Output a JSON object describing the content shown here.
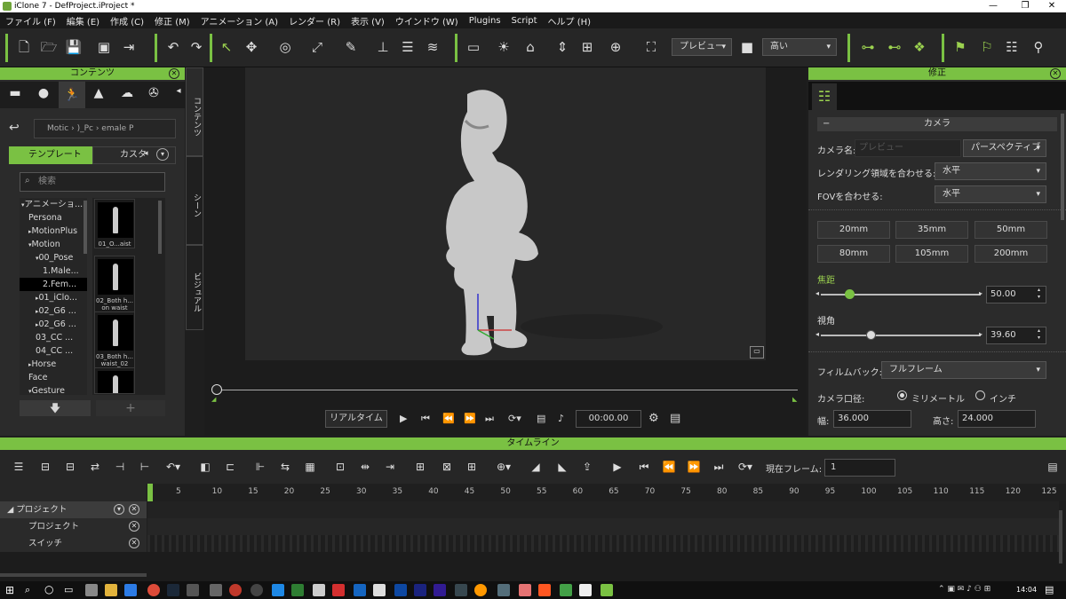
{
  "window": {
    "title": "iClone 7 - DefProject.iProject *"
  },
  "menu": [
    "ファイル (F)",
    "編集 (E)",
    "作成 (C)",
    "修正 (M)",
    "アニメーション (A)",
    "レンダー (R)",
    "表示 (V)",
    "ウインドウ (W)",
    "Plugins",
    "Script",
    "ヘルプ (H)"
  ],
  "toolbar": {
    "preview_select": "プレビュー",
    "quality_select": "高い"
  },
  "content_panel": {
    "title": "コンテンツ",
    "path": "Motic ›  )_Pc ›  emale P",
    "tab_template": "テンプレート",
    "tab_custom": "カスタ",
    "search_placeholder": "検索",
    "tree": [
      {
        "label": "アニメーショ...",
        "indent": 0,
        "arrow": "▾"
      },
      {
        "label": "Persona",
        "indent": 1,
        "arrow": ""
      },
      {
        "label": "MotionPlus",
        "indent": 1,
        "arrow": "▸"
      },
      {
        "label": "Motion",
        "indent": 1,
        "arrow": "▾"
      },
      {
        "label": "00_Pose",
        "indent": 2,
        "arrow": "▾"
      },
      {
        "label": "1.Male...",
        "indent": 3,
        "arrow": ""
      },
      {
        "label": "2.Fem...",
        "indent": 3,
        "arrow": "",
        "selected": true
      },
      {
        "label": "01_iClo...",
        "indent": 2,
        "arrow": "▸"
      },
      {
        "label": "02_G6 ...",
        "indent": 2,
        "arrow": "▸"
      },
      {
        "label": "02_G6 ...",
        "indent": 2,
        "arrow": "▸"
      },
      {
        "label": "03_CC ...",
        "indent": 2,
        "arrow": ""
      },
      {
        "label": "04_CC ...",
        "indent": 2,
        "arrow": ""
      },
      {
        "label": "Horse",
        "indent": 1,
        "arrow": "▸"
      },
      {
        "label": "Face",
        "indent": 1,
        "arrow": ""
      },
      {
        "label": "Gesture",
        "indent": 1,
        "arrow": "▾"
      }
    ],
    "thumbs": [
      {
        "caption": "01_O...aist"
      },
      {
        "caption": "02_Both h... on waist"
      },
      {
        "caption": "03_Both h... waist_02"
      },
      {
        "caption": ""
      }
    ],
    "vertical_tabs": [
      "コンテンツ",
      "シーン",
      "ビジュアル"
    ]
  },
  "playback": {
    "realtime": "リアルタイム",
    "time": "00:00.00"
  },
  "modify_panel": {
    "title": "修正",
    "section": "カメラ",
    "camera_name_label": "カメラ名:",
    "camera_name_placeholder": "プレビュー",
    "projection": "パースペクティブ",
    "render_area_label": "レンダリング領域を合わせる:",
    "render_area_value": "水平",
    "fov_label": "FOVを合わせる:",
    "fov_value": "水平",
    "lenses": [
      "20mm",
      "35mm",
      "50mm",
      "80mm",
      "105mm",
      "200mm"
    ],
    "focal_label": "焦距",
    "focal_value": "50.00",
    "focal_fraction": 0.18,
    "view_label": "視角",
    "view_value": "39.60",
    "view_fraction": 0.31,
    "filmback_label": "フィルムバック:",
    "filmback_value": "フルフレーム",
    "aperture_label": "カメラ口径:",
    "unit_mm": "ミリメートル",
    "unit_inch": "インチ",
    "width_label": "幅:",
    "width_value": "36.000",
    "height_label": "高さ:",
    "height_value": "24.000"
  },
  "timeline": {
    "title": "タイムライン",
    "current_frame_label": "現在フレーム:",
    "current_frame": "1",
    "ticks": [
      "5",
      "10",
      "15",
      "20",
      "25",
      "30",
      "35",
      "40",
      "45",
      "50",
      "55",
      "60",
      "65",
      "70",
      "75",
      "80",
      "85",
      "90",
      "95",
      "100",
      "105",
      "110",
      "115",
      "120",
      "125"
    ],
    "rows": [
      {
        "label": "プロジェクト",
        "level": 0
      },
      {
        "label": "プロジェクト",
        "level": 1
      },
      {
        "label": "スイッチ",
        "level": 1
      }
    ]
  },
  "taskbar": {
    "clock": "14:04"
  }
}
